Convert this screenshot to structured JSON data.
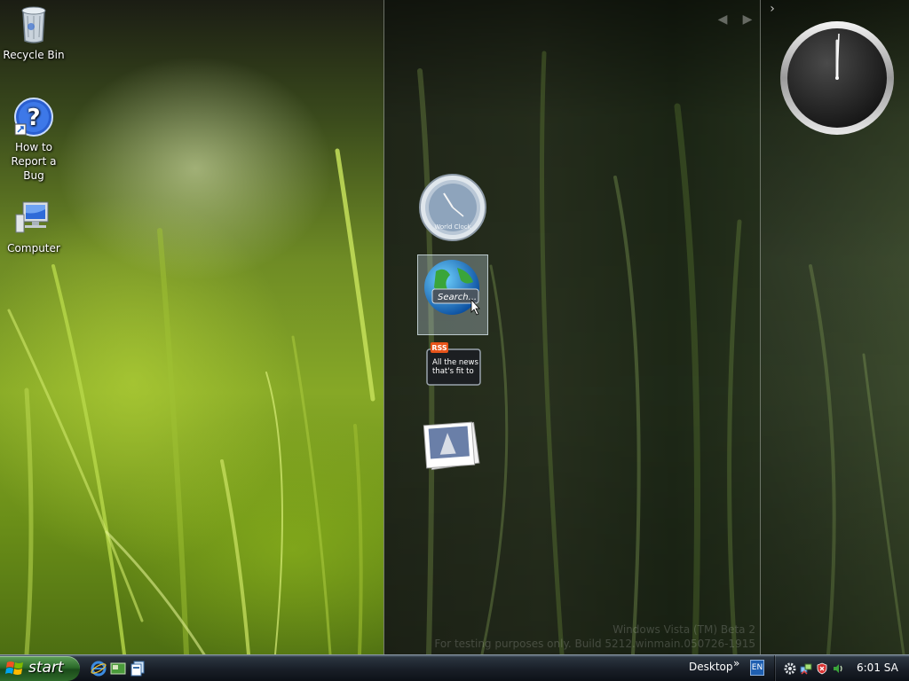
{
  "desktop": {
    "icons": [
      {
        "label": "Recycle Bin",
        "icon": "recycle-bin-icon"
      },
      {
        "label": "How to Report a Bug",
        "icon": "help-question-icon"
      },
      {
        "label": "Computer",
        "icon": "computer-icon"
      }
    ]
  },
  "sidebar": {
    "gadgets": [
      {
        "label": "World Clock",
        "icon": "world-clock-gadget-icon"
      },
      {
        "label": "Search...",
        "icon": "search-globe-gadget-icon",
        "selected": true
      },
      {
        "badge": "RSS",
        "text_line1": "All the news",
        "text_line2": "that's fit to",
        "icon": "rss-feed-gadget-icon"
      },
      {
        "label": "",
        "icon": "photo-slideshow-gadget-icon"
      }
    ],
    "nav_prev": "◀",
    "nav_next": "▶",
    "collapse_arrow": "›"
  },
  "watermark": {
    "line1": "Windows Vista (TM) Beta 2",
    "line2": "For testing purposes only. Build 5212.winmain.050726-1915"
  },
  "taskbar": {
    "start_label": "start",
    "quick_launch": [
      "internet-explorer-icon",
      "show-desktop-icon",
      "switch-windows-icon"
    ],
    "desktop_toolbar_label": "Desktop",
    "chevron": "»",
    "language": "EN",
    "tray_icons": [
      "settings-gear-icon",
      "network-icon",
      "security-shield-icon",
      "volume-icon"
    ],
    "clock": "6:01 SA"
  },
  "colors": {
    "taskbar_bg": "#1a2029",
    "start_green": "#2c6b2a",
    "grass_light": "#86a826",
    "sidebar_dark": "#242b1c"
  }
}
